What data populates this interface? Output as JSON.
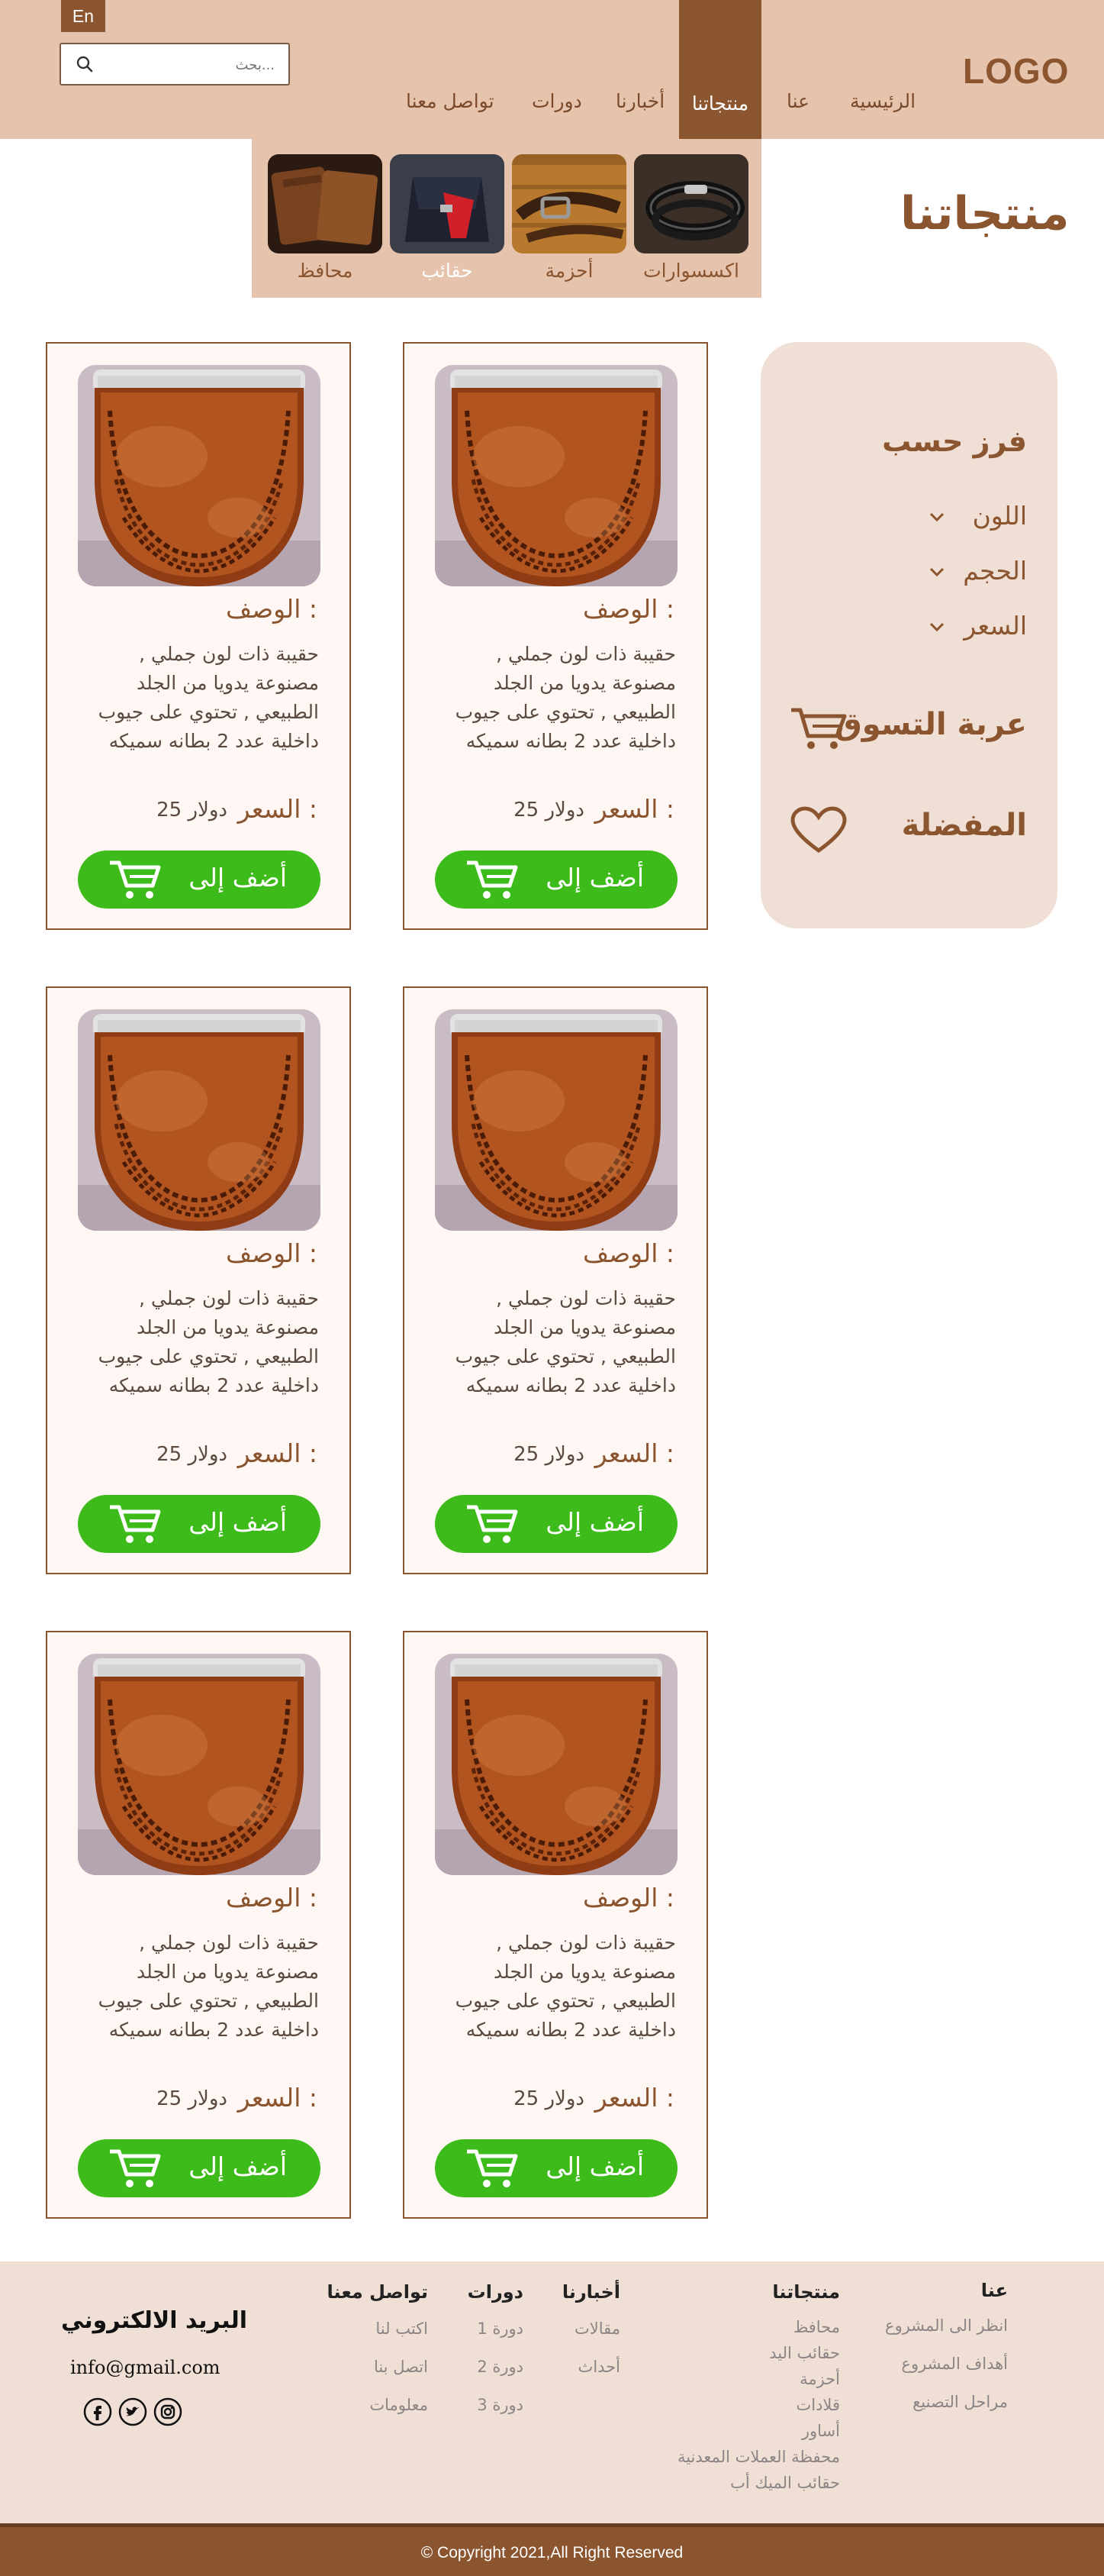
{
  "header": {
    "logo": "LOGO",
    "lang_button": "En",
    "search_placeholder": "...بحث",
    "nav": [
      "الرئيسية",
      "عنا",
      "منتجاتنا",
      "أخبارنا",
      "دورات",
      "تواصل معنا"
    ],
    "active_nav": "منتجاتنا"
  },
  "page_title": "منتجاتنا",
  "categories": [
    {
      "label": "اكسسوارات",
      "icon": "bracelet-image"
    },
    {
      "label": "أحزمة",
      "icon": "belt-image"
    },
    {
      "label": "حقائب",
      "icon": "bag-image",
      "active": true
    },
    {
      "label": "محافظ",
      "icon": "wallet-image"
    }
  ],
  "sidebar": {
    "sort_title": "فرز حسب",
    "filters": [
      "اللون",
      "الحجم",
      "السعر"
    ],
    "cart": "عربة التسوق",
    "favorites": "المفضلة"
  },
  "product": {
    "desc_title": "الوصف :",
    "desc": "حقيبة ذات لون جملي , مصنوعة يدويا من الجلد الطبيعي , تحتوي على جيوب داخلية عدد 2 بطانه سميكه",
    "price_label": "السعر :",
    "price_value": "25 دولار",
    "add_button": "أضف إلى"
  },
  "footer": {
    "about": {
      "title": "عنا",
      "links": [
        "انظر الى المشروع",
        "أهداف المشروع",
        "مراحل التصنيع"
      ]
    },
    "products": {
      "title": "منتجاتنا",
      "links": [
        "محافظ",
        "حقائب اليد",
        "أحزمة",
        "قلادات",
        "أساور",
        "محفظة العملات المعدنية",
        "حقائب الميك أب"
      ]
    },
    "news": {
      "title": "أخبارنا",
      "links": [
        "مقالات",
        "أحداث"
      ]
    },
    "courses": {
      "title": "دورات",
      "links": [
        "دورة 1",
        "دورة 2",
        "دورة 3"
      ]
    },
    "contact": {
      "title": "تواصل معنا",
      "links": [
        "اكتب لنا",
        "اتصل بنا",
        "معلومات"
      ]
    },
    "email_title": "البريد الالكتروني",
    "email": "info@gmail.com",
    "social": [
      "facebook-icon",
      "twitter-icon",
      "instagram-icon"
    ],
    "copyright": "© Copyright 2021,All Right Reserved"
  },
  "colors": {
    "brand": "#8b5530",
    "header_bg": "#e6c3ac",
    "button_green": "#3dbb1a",
    "panel_bg": "#efdfd5"
  }
}
